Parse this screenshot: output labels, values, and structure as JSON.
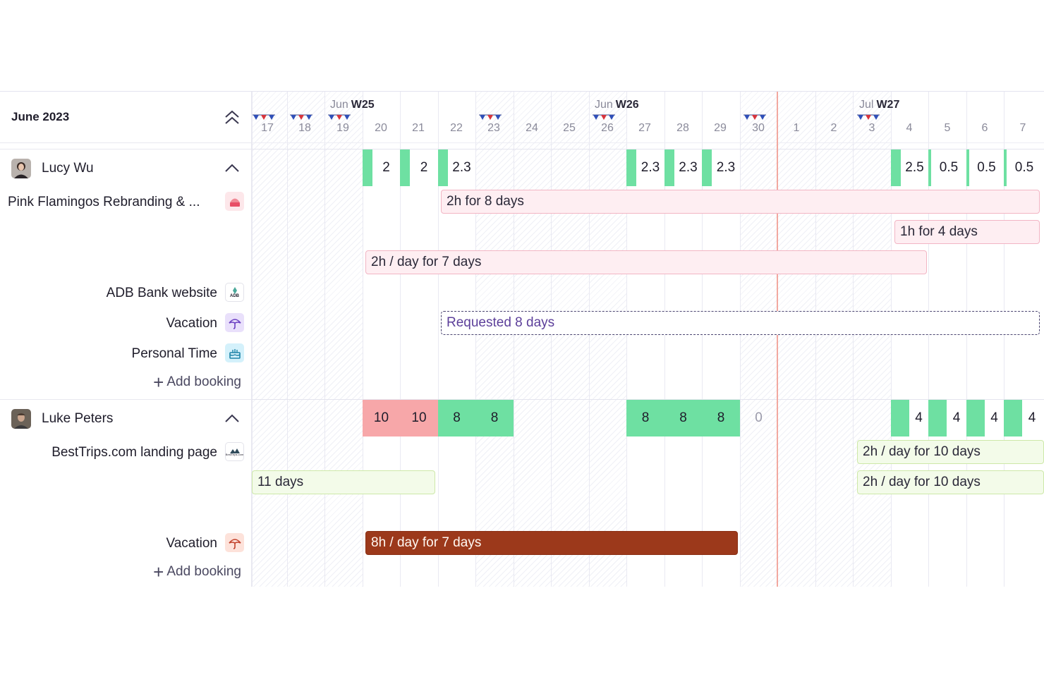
{
  "header": {
    "month": "June 2023"
  },
  "timeline": {
    "weeks": [
      {
        "month": "Jun",
        "week": "W25"
      },
      {
        "month": "Jun",
        "week": "W26"
      },
      {
        "month": "Jul",
        "week": "W27"
      }
    ],
    "days": [
      "17",
      "18",
      "19",
      "20",
      "21",
      "22",
      "23",
      "24",
      "25",
      "26",
      "27",
      "28",
      "29",
      "30",
      "1",
      "2",
      "3",
      "4",
      "5",
      "6",
      "7"
    ],
    "holidays": [
      "17",
      "18",
      "19",
      "23",
      "26",
      "30",
      "3"
    ]
  },
  "people": [
    {
      "name": "Lucy Wu",
      "capacity": [
        "2",
        "2",
        "2.3",
        "2.3",
        "2.3",
        "2.3",
        "2.5",
        "0.5",
        "0.5",
        "0.5"
      ],
      "projects": [
        {
          "name": "Pink Flamingos Rebranding & ...",
          "icon": "cupcake-icon"
        },
        {
          "name": "ADB Bank website",
          "icon": "adb-logo-icon",
          "logo_text": "ADB"
        },
        {
          "name": "Vacation",
          "icon": "umbrella-icon"
        },
        {
          "name": "Personal Time",
          "icon": "cake-icon"
        }
      ],
      "bookings": [
        "2h for 8 days",
        "1h for 4 days",
        "2h / day for 7 days",
        "Requested 8 days"
      ],
      "add_booking": "Add booking"
    },
    {
      "name": "Luke Peters",
      "capacity": [
        "10",
        "10",
        "8",
        "8",
        "8",
        "8",
        "8",
        "0",
        "4",
        "4",
        "4",
        "4"
      ],
      "projects": [
        {
          "name": "BestTrips.com landing page",
          "icon": "besttrips-logo-icon",
          "logo_text": "BestTrips.com"
        },
        {
          "name": "Vacation",
          "icon": "umbrella-icon"
        }
      ],
      "bookings": [
        "2h / day for 10 days",
        "11 days",
        "2h / day for 10 days",
        "8h / day for 7 days"
      ],
      "add_booking": "Add booking"
    }
  ],
  "colors": {
    "capacity_green": "#6ee0a2",
    "overbooked_red": "#f7a7a9",
    "today_line": "#f2a8a0",
    "vacation_rust": "#9c391b",
    "request_outline": "#4a4470"
  }
}
